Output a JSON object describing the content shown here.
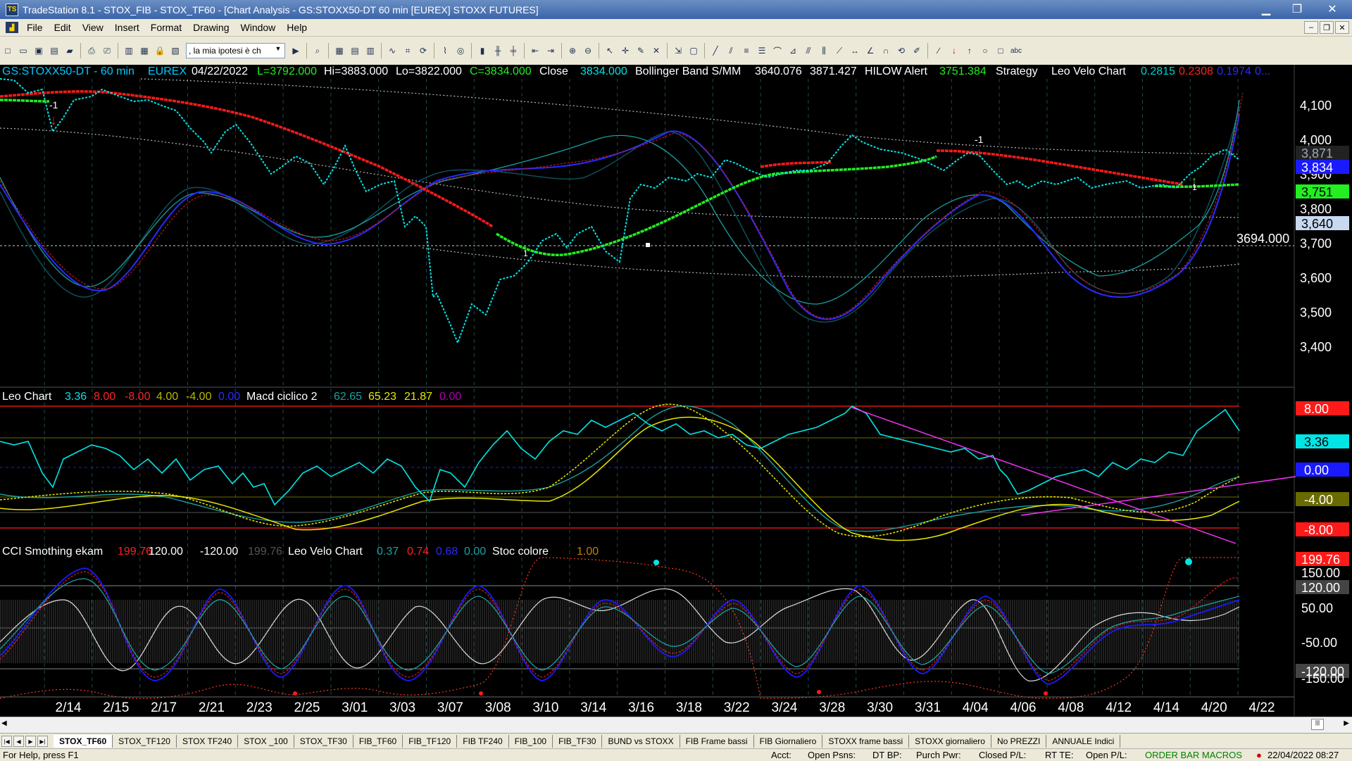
{
  "window": {
    "title": "TradeStation 8.1 - STOX_FIB - STOX_TF60 - [Chart Analysis - GS:STOXX50-DT  60 min  [EUREX] STOXX FUTURES]",
    "minimize": "▁",
    "maximize": "❐",
    "close": "✕"
  },
  "menu": [
    "File",
    "Edit",
    "View",
    "Insert",
    "Format",
    "Drawing",
    "Window",
    "Help"
  ],
  "toolbar": {
    "strategy_select": ", la mia ipotesi è ch"
  },
  "price_header": {
    "symbol": "GS:STOXX50-DT - 60 min",
    "exchange": "EUREX",
    "date": "04/22/2022",
    "last": "L=3792.000",
    "high": "Hi=3883.000",
    "low": "Lo=3822.000",
    "close_val": "C=3834.000",
    "close_label": "Close",
    "close_num": "3834.000",
    "bb_label": "Bollinger Band S/MM",
    "bb1": "3640.076",
    "bb2": "3871.427",
    "hilow_label": "HILOW Alert",
    "hilow_val": "3751.384",
    "strategy_label": "Strategy",
    "velo_label": "Leo Velo Chart",
    "v1": "0.2815",
    "v2": "0.2308",
    "v3": "0.1974",
    "v4": "0..."
  },
  "price_axis": [
    "4,100",
    "4,000",
    "3,900",
    "3,800",
    "3,700",
    "3,600",
    "3,500",
    "3,400"
  ],
  "price_tags": {
    "t3871": "3,871",
    "t3834": "3,834",
    "t3751": "3,751",
    "t3640": "3,640",
    "hline": "3694.000"
  },
  "markers": {
    "m1": "-1",
    "m2": "-1",
    "m3": "1",
    "m4": "1"
  },
  "leo_header": {
    "label": "Leo Chart",
    "v1": "3.36",
    "v2": "8.00",
    "v3": "-8.00",
    "v4": "4.00",
    "v5": "-4.00",
    "v6": "0.00",
    "macd_label": "Macd ciclico 2",
    "m1": "62.65",
    "m2": "65.23",
    "m3": "21.87",
    "m4": "0.00"
  },
  "leo_tags": {
    "p8": "8.00",
    "p336": "3.36",
    "p0": "0.00",
    "m4": "-4.00",
    "m8": "-8.00"
  },
  "cci_header": {
    "label": "CCI Smothing ekam",
    "v1": "199.76",
    "v2": "120.00",
    "v3": "-120.00",
    "v4": "199.76",
    "velo_label": "Leo Velo Chart",
    "w1": "0.37",
    "w2": "0.74",
    "w3": "0.68",
    "w4": "0.00",
    "stoc_label": "Stoc colore",
    "s1": "1.00"
  },
  "cci_tags": {
    "t199": "199.76",
    "t150": "150.00",
    "t120": "120.00",
    "t50": "50.00",
    "tm50": "-50.00",
    "tm120": "-120.00",
    "tm150": "-150.00"
  },
  "dates": [
    "2/14",
    "2/15",
    "2/17",
    "2/21",
    "2/23",
    "2/25",
    "3/01",
    "3/03",
    "3/07",
    "3/08",
    "3/10",
    "3/14",
    "3/16",
    "3/18",
    "3/22",
    "3/24",
    "3/28",
    "3/30",
    "3/31",
    "4/04",
    "4/06",
    "4/08",
    "4/12",
    "4/14",
    "4/20",
    "4/22"
  ],
  "tabs": [
    "STOX_TF60",
    "STOX_TF120",
    "STOX TF240",
    "STOX _100",
    "STOX_TF30",
    "FIB_TF60",
    "FIB_TF120",
    "FIB TF240",
    "FIB_100",
    "FIB_TF30",
    "BUND vs STOXX",
    "FIB Frame bassi",
    "FIB Giornaliero",
    "STOXX frame bassi",
    "STOXX giornaliero",
    "No PREZZI",
    "ANNUALE Indici"
  ],
  "status": {
    "help": "For Help, press F1",
    "acct": "Acct:",
    "open_psns": "Open Psns:",
    "dt_bp": "DT BP:",
    "purch_pwr": "Purch Pwr:",
    "closed_pl": "Closed P/L:",
    "rt_te": "RT TE:",
    "open_pl": "Open P/L:",
    "macros": "ORDER BAR  MACROS",
    "datetime": "22/04/2022 08:27"
  },
  "colors": {
    "cyan": "#00e5e5",
    "red": "#ff1a1a",
    "green": "#22ee22",
    "magenta": "#ff33ff",
    "yellow": "#e8e800",
    "blue": "#1a1aff"
  }
}
